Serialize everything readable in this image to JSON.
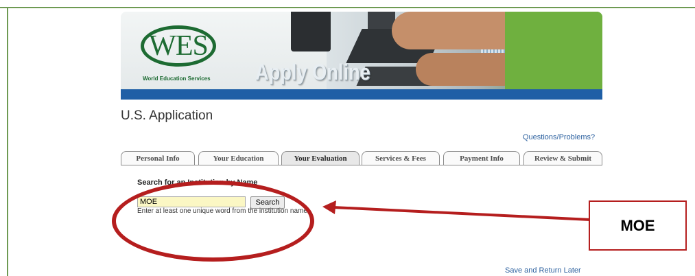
{
  "header": {
    "logo_text": "WES",
    "logo_subtitle": "World Education Services",
    "banner_text": "Apply Online"
  },
  "page": {
    "title": "U.S. Application",
    "help_link": "Questions/Problems?",
    "save_link": "Save and Return Later"
  },
  "tabs": [
    {
      "label": "Personal Info"
    },
    {
      "label": "Your Education"
    },
    {
      "label": "Your Evaluation",
      "active": true
    },
    {
      "label": "Services & Fees"
    },
    {
      "label": "Payment Info"
    },
    {
      "label": "Review & Submit"
    }
  ],
  "search": {
    "heading": "Search for an Institution by Name",
    "value": "MOE",
    "button_label": "Search",
    "hint": "Enter at least one unique word from the institution name."
  },
  "annotation": {
    "callout_text": "MOE",
    "color": "#b51e1e"
  },
  "colors": {
    "brand_green": "#1d6b32",
    "banner_blue": "#1f5fa6",
    "link_blue": "#2a5f9e",
    "input_highlight": "#fbf7c4"
  }
}
